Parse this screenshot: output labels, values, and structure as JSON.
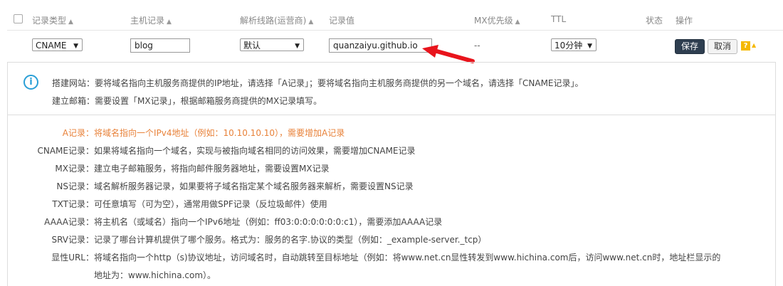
{
  "header": {
    "type": "记录类型",
    "host": "主机记录",
    "line": "解析线路(运营商)",
    "value": "记录值",
    "mx": "MX优先级",
    "ttl": "TTL",
    "status": "状态",
    "ops": "操作",
    "sort_glyph": "▲"
  },
  "row": {
    "type_value": "CNAME",
    "host_value": "blog",
    "line_value": "默认",
    "record_value": "quanzaiyu.github.io",
    "mx_value": "--",
    "ttl_value": "10分钟",
    "save_label": "保存",
    "cancel_label": "取消",
    "help_glyph": "?",
    "collapse_glyph": "▲",
    "caret": "▼"
  },
  "tips": {
    "line1_label": "搭建网站：",
    "line1_text": "要将域名指向主机服务商提供的IP地址，请选择「A记录」；要将域名指向主机服务商提供的另一个域名，请选择「CNAME记录」。",
    "line2_label": "建立邮箱：",
    "line2_text": "需要设置「MX记录」，根据邮箱服务商提供的MX记录填写。"
  },
  "records": [
    {
      "label": "A记录：",
      "text": "将域名指向一个IPv4地址（例如：10.10.10.10），需要增加A记录"
    },
    {
      "label": "CNAME记录：",
      "text": "如果将域名指向一个域名，实现与被指向域名相同的访问效果，需要增加CNAME记录"
    },
    {
      "label": "MX记录：",
      "text": "建立电子邮箱服务，将指向邮件服务器地址，需要设置MX记录"
    },
    {
      "label": "NS记录：",
      "text": "域名解析服务器记录，如果要将子域名指定某个域名服务器来解析，需要设置NS记录"
    },
    {
      "label": "TXT记录：",
      "text": "可任意填写（可为空），通常用做SPF记录（反垃圾邮件）使用"
    },
    {
      "label": "AAAA记录：",
      "text": "将主机名（或域名）指向一个IPv6地址（例如：ff03:0:0:0:0:0:0:c1），需要添加AAAA记录"
    },
    {
      "label": "SRV记录：",
      "text": "记录了哪台计算机提供了哪个服务。格式为：服务的名字.协议的类型（例如：_example-server._tcp）"
    },
    {
      "label": "显性URL：",
      "text": "将域名指向一个http（s)协议地址，访问域名时，自动跳转至目标地址（例如：将www.net.cn显性转发到www.hichina.com后，访问www.net.cn时，地址栏显示的"
    },
    {
      "label": "",
      "text": "地址为：www.hichina.com）。"
    }
  ],
  "colors": {
    "highlight": "#e8823a",
    "info": "#2a9fd6",
    "save_bg": "#2e3e50",
    "arrow": "#e8141c",
    "help": "#f5b800"
  },
  "info_icon_glyph": "i"
}
